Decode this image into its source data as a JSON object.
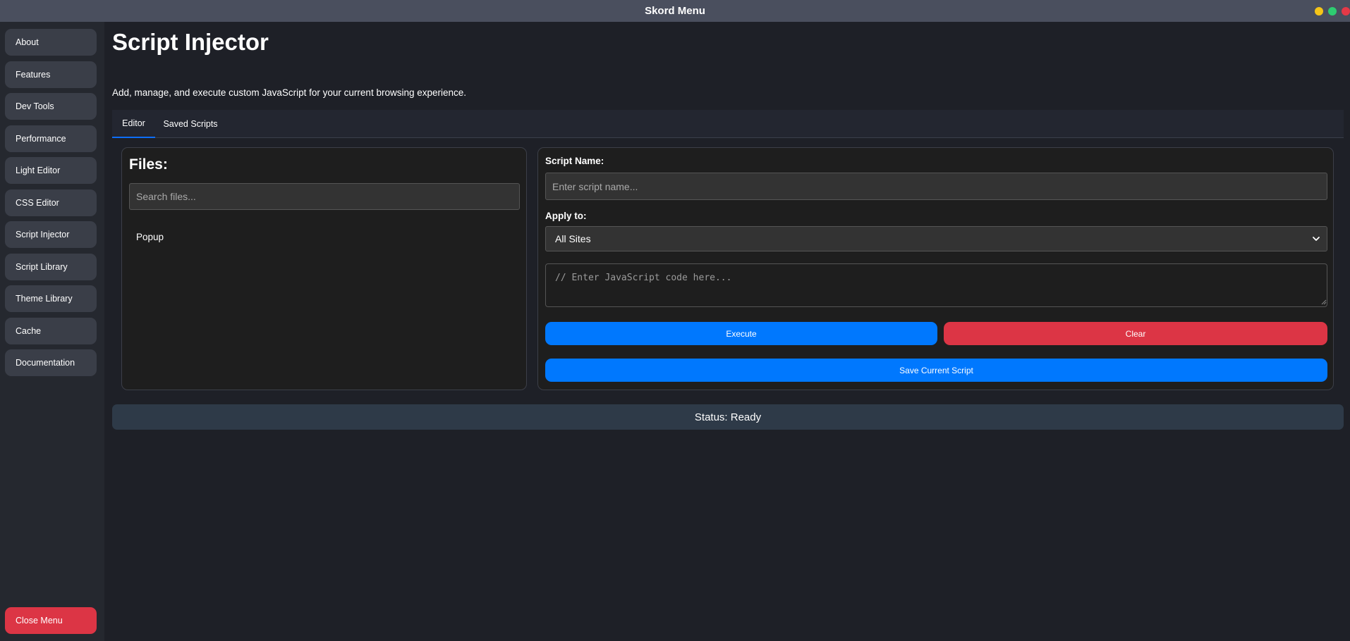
{
  "window": {
    "title": "Skord Menu",
    "controls": [
      {
        "name": "minimize",
        "color": "#f5c518"
      },
      {
        "name": "maximize",
        "color": "#2ecc71"
      },
      {
        "name": "close",
        "color": "#e53947"
      }
    ]
  },
  "sidebar": {
    "items": [
      {
        "label": "About"
      },
      {
        "label": "Features"
      },
      {
        "label": "Dev Tools"
      },
      {
        "label": "Performance"
      },
      {
        "label": "Light Editor"
      },
      {
        "label": "CSS Editor"
      },
      {
        "label": "Script Injector"
      },
      {
        "label": "Script Library"
      },
      {
        "label": "Theme Library"
      },
      {
        "label": "Cache"
      },
      {
        "label": "Documentation"
      }
    ],
    "close_label": "Close Menu"
  },
  "main": {
    "title": "Script Injector",
    "description": "Add, manage, and execute custom JavaScript for your current browsing experience.",
    "tabs": [
      {
        "label": "Editor",
        "active": true
      },
      {
        "label": "Saved Scripts",
        "active": false
      }
    ]
  },
  "files": {
    "heading": "Files:",
    "search_placeholder": "Search files...",
    "search_value": "",
    "items": [
      "Popup"
    ]
  },
  "editor": {
    "name_label": "Script Name:",
    "name_placeholder": "Enter script name...",
    "name_value": "",
    "apply_label": "Apply to:",
    "apply_selected": "All Sites",
    "code_placeholder": "// Enter JavaScript code here...",
    "execute_label": "Execute",
    "clear_label": "Clear",
    "save_label": "Save Current Script"
  },
  "status": {
    "text": "Status: Ready"
  },
  "colors": {
    "accent": "#0d6efd",
    "execute": "#0078fe",
    "danger": "#dc3545",
    "status_bg": "#2e3a48"
  }
}
